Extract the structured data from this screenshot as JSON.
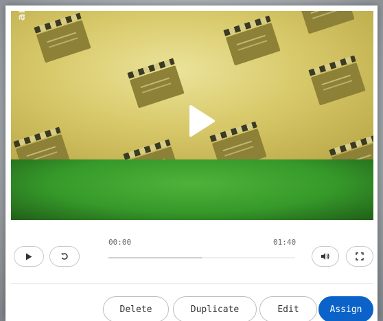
{
  "player": {
    "logo_text": "arte",
    "time_current": "00:00",
    "time_total": "01:40",
    "progress_fraction": 0.5,
    "icons": {
      "big_play": "play-icon",
      "play": "play-icon",
      "replay": "replay-icon",
      "volume": "volume-icon",
      "fullscreen": "fullscreen-icon"
    }
  },
  "actions": {
    "delete_label": "Delete",
    "duplicate_label": "Duplicate",
    "edit_label": "Edit",
    "assign_label": "Assign"
  },
  "colors": {
    "accent": "#0b63c9",
    "video_top": "#d8c96a",
    "video_bottom": "#369a2a"
  }
}
